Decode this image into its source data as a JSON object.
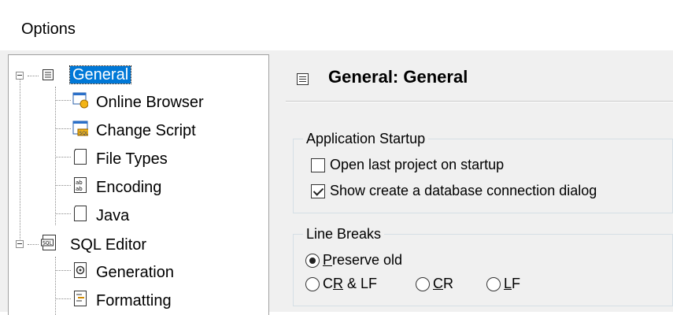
{
  "window": {
    "title": "Options"
  },
  "tree": {
    "items": [
      {
        "label": "General",
        "icon": "general-page-icon",
        "selected": true
      },
      {
        "label": "Online Browser",
        "icon": "online-browser-icon"
      },
      {
        "label": "Change Script",
        "icon": "sql-script-icon"
      },
      {
        "label": "File Types",
        "icon": "page-icon"
      },
      {
        "label": "Encoding",
        "icon": "encoding-icon"
      },
      {
        "label": "Java",
        "icon": "page-icon"
      },
      {
        "label": "SQL Editor",
        "icon": "sql-editor-icon"
      },
      {
        "label": "Generation",
        "icon": "generation-gear-icon"
      },
      {
        "label": "Formatting",
        "icon": "formatting-icon"
      }
    ]
  },
  "page": {
    "title": "General: General",
    "application_startup": {
      "label": "Application Startup",
      "open_last_project": {
        "label": "Open last project on startup",
        "checked": false
      },
      "show_create_db": {
        "label": "Show create a database connection dialog",
        "checked": true
      }
    },
    "line_breaks": {
      "label": "Line Breaks",
      "preserve_old": {
        "label_prefix": "",
        "accel": "P",
        "label_rest": "reserve old",
        "checked": true
      },
      "crlf": {
        "pre": "C",
        "accel": "R",
        "post": " & LF"
      },
      "cr": {
        "pre": "",
        "accel": "C",
        "post": "R"
      },
      "lf": {
        "pre": "",
        "accel": "L",
        "post": "F"
      }
    }
  }
}
